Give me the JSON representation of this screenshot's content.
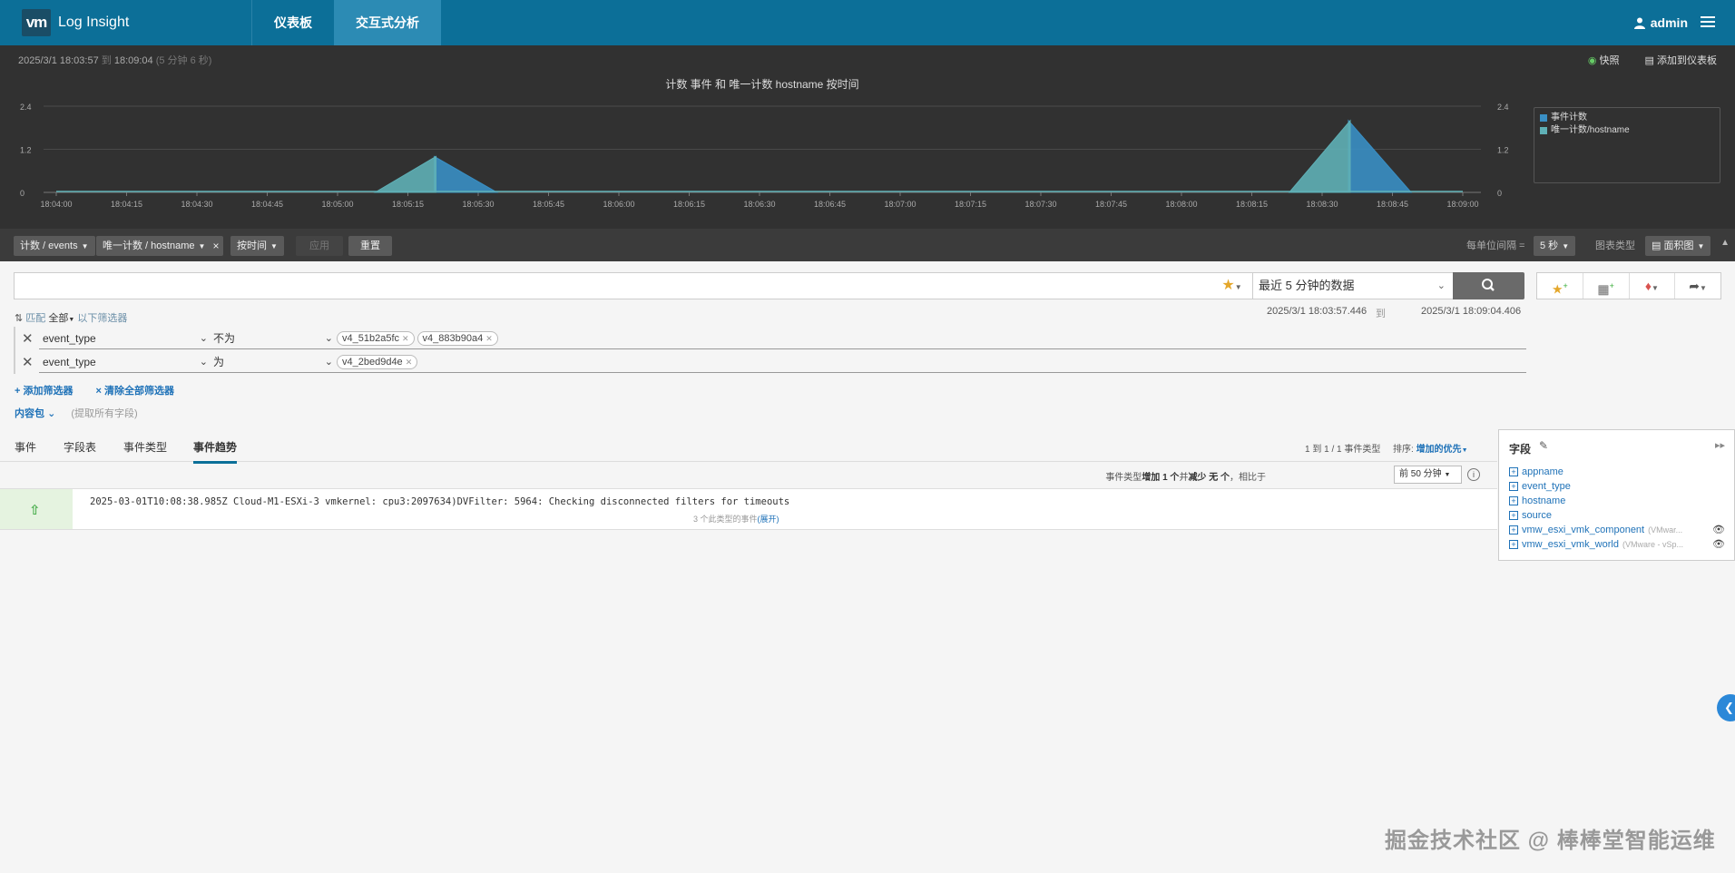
{
  "app": {
    "logo_badge": "vm",
    "title": "Log Insight"
  },
  "nav": {
    "tabs": [
      {
        "label": "仪表板"
      },
      {
        "label": "交互式分析"
      }
    ],
    "user": "admin"
  },
  "chart_panel": {
    "time_from": "2025/3/1  18:03:57",
    "time_to_word": "到",
    "time_to": "18:09:04",
    "duration": "(5 分钟 6 秒)",
    "snapshot_label": "快照",
    "add_dashboard_label": "添加到仪表板"
  },
  "chart_data": {
    "type": "area",
    "title": "计数 事件 和 唯一计数 hostname 按时间",
    "x_ticks": [
      "18:04:00",
      "18:04:15",
      "18:04:30",
      "18:04:45",
      "18:05:00",
      "18:05:15",
      "18:05:30",
      "18:05:45",
      "18:06:00",
      "18:06:15",
      "18:06:30",
      "18:06:45",
      "18:07:00",
      "18:07:15",
      "18:07:30",
      "18:07:45",
      "18:08:00",
      "18:08:15",
      "18:08:30",
      "18:08:45",
      "18:09:00"
    ],
    "y_ticks": [
      "0",
      "1.2",
      "2.4"
    ],
    "ylim": [
      0,
      2.4
    ],
    "series": [
      {
        "name": "事件计数",
        "color": "#3a8fc4",
        "points": [
          [
            "18:05:21",
            1
          ],
          [
            "18:08:36",
            2
          ]
        ]
      },
      {
        "name": "唯一计数/hostname",
        "color": "#5fb0b6",
        "points": [
          [
            "18:05:21",
            1
          ],
          [
            "18:08:36",
            2
          ]
        ]
      }
    ]
  },
  "toolbar": {
    "pill_count": "计数 / events",
    "pill_unique": "唯一计数 / hostname",
    "pill_remove": "×",
    "pill_time": "按时间",
    "apply": "应用",
    "reset": "重置",
    "interval_label": "每单位间隔 =",
    "interval_value": "5 秒",
    "chart_type_label": "图表类型",
    "chart_type_value": "面积图"
  },
  "search": {
    "query": "",
    "time_select": "最近 5 分钟的数据"
  },
  "filters": {
    "match_prefix": "匹配",
    "match_value": "全部",
    "match_suffix": "以下筛选器",
    "ts_from": "2025/3/1 18:03:57.446",
    "ts_to_word": "到",
    "ts_to": "2025/3/1 18:09:04.406",
    "rows": [
      {
        "field": "event_type",
        "op": "不为",
        "values": [
          "v4_51b2a5fc",
          "v4_883b90a4"
        ]
      },
      {
        "field": "event_type",
        "op": "为",
        "values": [
          "v4_2bed9d4e"
        ]
      }
    ],
    "add_label": "+ 添加筛选器",
    "clear_label": "× 清除全部筛选器",
    "content_pack": "内容包",
    "content_pack_hint": "(提取所有字段)"
  },
  "tabs": [
    {
      "label": "事件"
    },
    {
      "label": "字段表"
    },
    {
      "label": "事件类型"
    },
    {
      "label": "事件趋势"
    }
  ],
  "results": {
    "range_text": "1 到 1 / 1 事件类型",
    "sort_label": "排序:",
    "sort_value": "增加的优先",
    "trend_prefix": "事件类型",
    "trend_bold1": "增加 1 个",
    "trend_mid": "并",
    "trend_bold2": "减少 无 个",
    "trend_suffix": "，相比于",
    "compare_select": "前 50 分钟",
    "info": "i"
  },
  "events": [
    {
      "text": "2025-03-01T10:08:38.985Z Cloud-M1-ESXi-3 vmkernel: cpu3:2097634)DVFilter: 5964: Checking disconnected filters for timeouts",
      "sub": "3 个此类型的事件",
      "expand": "(展开)"
    }
  ],
  "fields_panel": {
    "title": "字段",
    "items": [
      {
        "name": "appname",
        "hint": ""
      },
      {
        "name": "event_type",
        "hint": ""
      },
      {
        "name": "hostname",
        "hint": ""
      },
      {
        "name": "source",
        "hint": ""
      },
      {
        "name": "vmw_esxi_vmk_component",
        "hint": "(VMwar..."
      },
      {
        "name": "vmw_esxi_vmk_world",
        "hint": "(VMware - vSp..."
      }
    ]
  },
  "watermark": "掘金技术社区 @ 棒棒堂智能运维"
}
